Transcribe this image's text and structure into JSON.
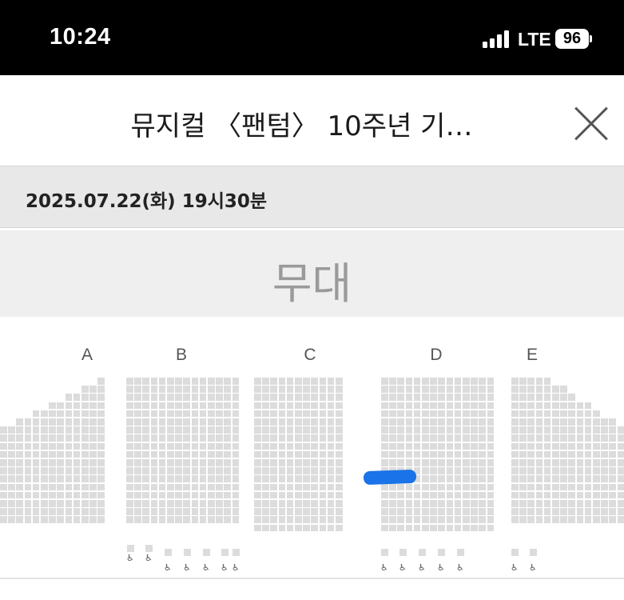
{
  "status_bar": {
    "time": "10:24",
    "network": "LTE",
    "battery": "96",
    "signal_icon": "cellular-signal-icon"
  },
  "header": {
    "title": "뮤지컬 〈팬텀〉 10주년 기…",
    "close_icon": "close-icon"
  },
  "performance": {
    "datetime": "2025.07.22(화) 19시30분"
  },
  "stage": {
    "label": "무대"
  },
  "seat_map": {
    "sections": [
      {
        "label": "A"
      },
      {
        "label": "B"
      },
      {
        "label": "C"
      },
      {
        "label": "D"
      },
      {
        "label": "E"
      }
    ],
    "wheelchair_icon": "wheelchair-icon",
    "seat_color": "#dcdcdc",
    "selected_color": "#1a73e8"
  }
}
